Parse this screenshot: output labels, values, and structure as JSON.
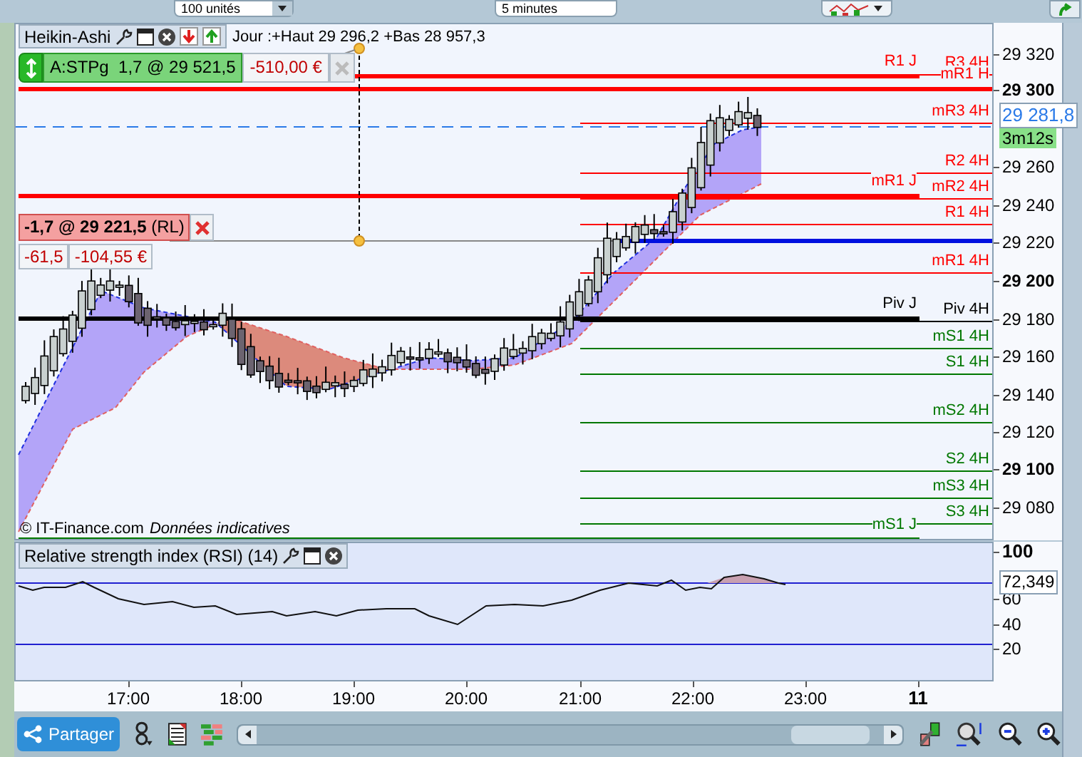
{
  "top_toolbar": {
    "quantity": "100 unités",
    "timeframe": "5 minutes"
  },
  "chart": {
    "title": "Heikin-Ashi",
    "info": "Jour :+Haut 29 296,2 +Bas 28 957,3",
    "stop_order": {
      "label": "A:STPg  1,7 @ 29 521,5",
      "pnl": "-510,00 €"
    },
    "position": {
      "label": "-1,7 @ 29 221,5",
      "tag": "(RL)",
      "points": "-61,5",
      "pnl": "-104,55 €"
    },
    "levels": [
      {
        "label": "R1 J",
        "kind": "daily",
        "color": "#ff0000"
      },
      {
        "label": "R3 4H",
        "kind": "intraday",
        "color": "#ff0000"
      },
      {
        "label": "mR1 H",
        "kind": "full",
        "color": "#ff0000"
      },
      {
        "label": "mR3 4H",
        "kind": "intraday",
        "color": "#ff0000"
      },
      {
        "label": "R2 4H",
        "kind": "intraday",
        "color": "#ff0000"
      },
      {
        "label": "mR1 J",
        "kind": "daily",
        "color": "#ff0000"
      },
      {
        "label": "mR2 4H",
        "kind": "intraday",
        "color": "#ff0000"
      },
      {
        "label": "R1 4H",
        "kind": "intraday",
        "color": "#ff0000"
      },
      {
        "label": "mR1 4H",
        "kind": "intraday",
        "color": "#ff0000"
      },
      {
        "label": "Piv J",
        "kind": "daily",
        "color": "#000000"
      },
      {
        "label": "Piv 4H",
        "kind": "intraday",
        "color": "#000000"
      },
      {
        "label": "mS1 4H",
        "kind": "intraday",
        "color": "#007700"
      },
      {
        "label": "S1 4H",
        "kind": "intraday",
        "color": "#007700"
      },
      {
        "label": "mS2 4H",
        "kind": "intraday",
        "color": "#007700"
      },
      {
        "label": "S2 4H",
        "kind": "intraday",
        "color": "#007700"
      },
      {
        "label": "mS3 4H",
        "kind": "intraday",
        "color": "#007700"
      },
      {
        "label": "S3 4H",
        "kind": "intraday",
        "color": "#007700"
      },
      {
        "label": "mS1 J",
        "kind": "daily",
        "color": "#007700"
      }
    ],
    "price_axis": [
      {
        "text": "29 320",
        "bold": false
      },
      {
        "text": "29 300",
        "bold": true
      },
      {
        "text": "29 260",
        "bold": false
      },
      {
        "text": "29 240",
        "bold": false
      },
      {
        "text": "29 220",
        "bold": false
      },
      {
        "text": "29 200",
        "bold": true
      },
      {
        "text": "29 180",
        "bold": false
      },
      {
        "text": "29 160",
        "bold": false
      },
      {
        "text": "29 140",
        "bold": false
      },
      {
        "text": "29 120",
        "bold": false
      },
      {
        "text": "29 100",
        "bold": true
      },
      {
        "text": "29 080",
        "bold": false
      }
    ],
    "current_price": "29 281,8",
    "countdown": "3m12s",
    "credit": "© IT-Finance.com",
    "disclaimer": "Données indicatives"
  },
  "rsi": {
    "title": "Relative strength index (RSI) (14)",
    "value": "72,349",
    "axis": [
      {
        "text": "100",
        "bold": true
      },
      {
        "text": "60",
        "bold": false
      },
      {
        "text": "40",
        "bold": false
      },
      {
        "text": "20",
        "bold": false
      }
    ]
  },
  "time_axis": [
    {
      "text": "17:00",
      "bold": false
    },
    {
      "text": "18:00",
      "bold": false
    },
    {
      "text": "19:00",
      "bold": false
    },
    {
      "text": "20:00",
      "bold": false
    },
    {
      "text": "21:00",
      "bold": false
    },
    {
      "text": "22:00",
      "bold": false
    },
    {
      "text": "23:00",
      "bold": false
    },
    {
      "text": "11",
      "bold": true
    }
  ],
  "bottom_toolbar": {
    "share_button": "Partager"
  }
}
